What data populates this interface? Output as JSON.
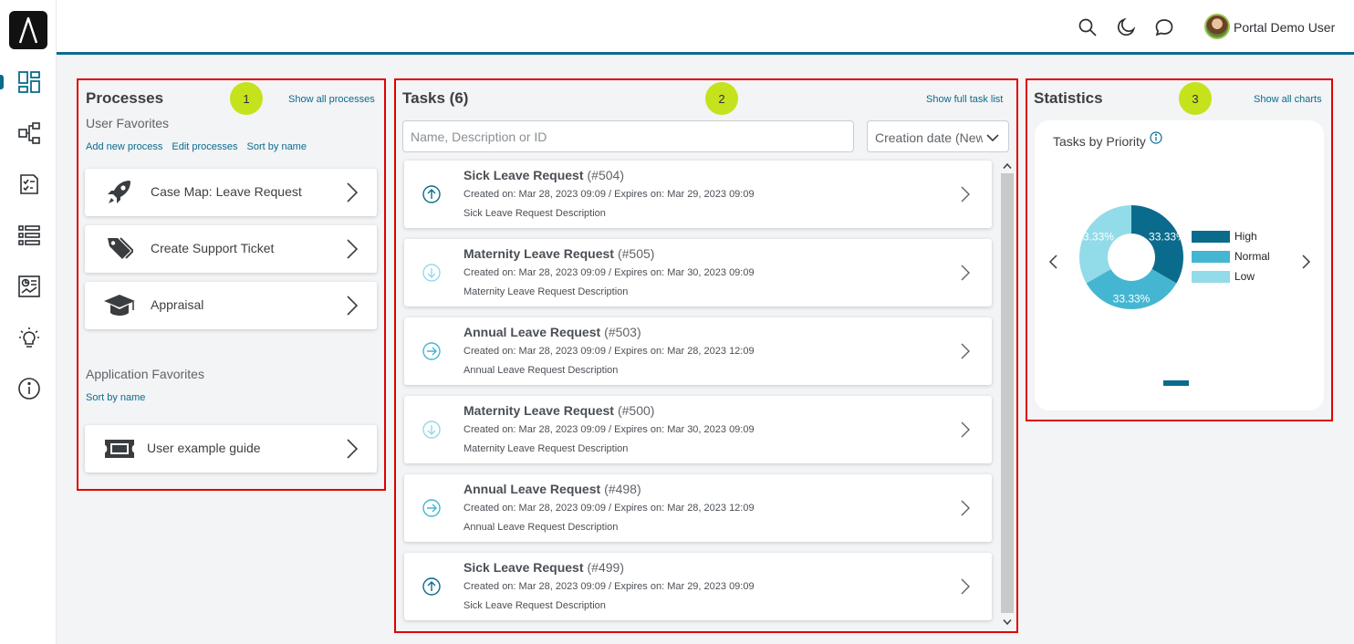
{
  "header": {
    "user_name": "Portal Demo User"
  },
  "sidebar": {
    "icons": [
      "dashboard-icon",
      "process-icon",
      "tasks-icon",
      "cases-icon",
      "statistics-icon",
      "idea-icon",
      "info-icon"
    ]
  },
  "processes": {
    "title": "Processes",
    "badge": "1",
    "show_all": "Show all processes",
    "user_favorites_label": "User Favorites",
    "links": {
      "add": "Add new process",
      "edit": "Edit processes",
      "sort": "Sort by name"
    },
    "items": [
      {
        "label": "Case Map: Leave Request",
        "icon": "rocket-icon"
      },
      {
        "label": "Create Support Ticket",
        "icon": "tag-icon"
      },
      {
        "label": "Appraisal",
        "icon": "graduation-cap-icon"
      }
    ],
    "app_favorites_label": "Application Favorites",
    "app_sort": "Sort by name",
    "app_items": [
      {
        "label": "User example guide",
        "icon": "ticket-icon"
      }
    ]
  },
  "tasks": {
    "title": "Tasks (6)",
    "badge": "2",
    "show_full": "Show full task list",
    "search_placeholder": "Name, Description or ID",
    "sort_value": "Creation date (Newest first)",
    "items": [
      {
        "name": "Sick Leave Request",
        "id": "(#504)",
        "dates": "Created on: Mar 28, 2023 09:09 / Expires on: Mar 29, 2023 09:09",
        "desc": "Sick Leave Request Description",
        "priority": "high"
      },
      {
        "name": "Maternity Leave Request",
        "id": "(#505)",
        "dates": "Created on: Mar 28, 2023 09:09 / Expires on: Mar 30, 2023 09:09",
        "desc": "Maternity Leave Request Description",
        "priority": "low"
      },
      {
        "name": "Annual Leave Request",
        "id": "(#503)",
        "dates": "Created on: Mar 28, 2023 09:09 / Expires on: Mar 28, 2023 12:09",
        "desc": "Annual Leave Request Description",
        "priority": "normal"
      },
      {
        "name": "Maternity Leave Request",
        "id": "(#500)",
        "dates": "Created on: Mar 28, 2023 09:09 / Expires on: Mar 30, 2023 09:09",
        "desc": "Maternity Leave Request Description",
        "priority": "low"
      },
      {
        "name": "Annual Leave Request",
        "id": "(#498)",
        "dates": "Created on: Mar 28, 2023 09:09 / Expires on: Mar 28, 2023 12:09",
        "desc": "Annual Leave Request Description",
        "priority": "normal"
      },
      {
        "name": "Sick Leave Request",
        "id": "(#499)",
        "dates": "Created on: Mar 28, 2023 09:09 / Expires on: Mar 29, 2023 09:09",
        "desc": "Sick Leave Request Description",
        "priority": "high"
      }
    ]
  },
  "statistics": {
    "title": "Statistics",
    "badge": "3",
    "show_all": "Show all charts",
    "chart_title": "Tasks by Priority"
  },
  "chart_data": {
    "type": "pie",
    "title": "Tasks by Priority",
    "categories": [
      "High",
      "Normal",
      "Low"
    ],
    "values": [
      33.33,
      33.33,
      33.33
    ],
    "labels": [
      "33.33%",
      "33.33%",
      "33.33%"
    ],
    "colors": [
      "#0b6b8c",
      "#45b6d1",
      "#92dbe8"
    ],
    "donut": true,
    "legend": "right"
  },
  "colors": {
    "accent": "#0b6b8c",
    "highlight_border": "#e00000",
    "badge": "#c5e21c"
  }
}
